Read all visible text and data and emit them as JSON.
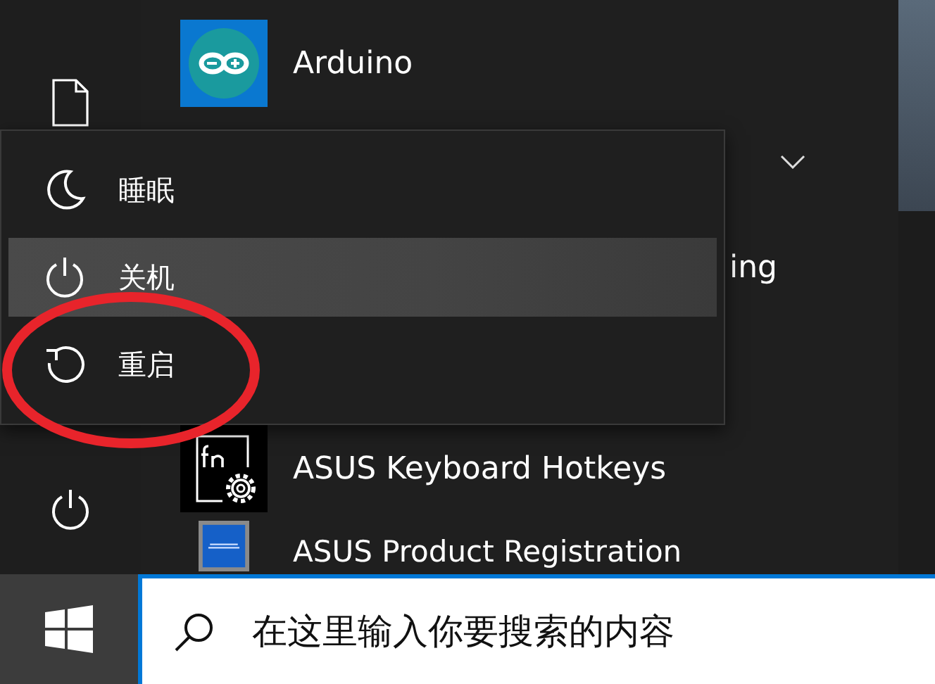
{
  "start_menu": {
    "apps": [
      {
        "kind": "strip"
      },
      {
        "kind": "app",
        "label": "Arduino"
      },
      {
        "kind": "strip"
      },
      {
        "kind": "group"
      },
      {
        "kind": "partial",
        "label": "ing"
      },
      {
        "kind": "app",
        "label": "ASUS Keyboard Hotkeys"
      },
      {
        "kind": "app",
        "label": "ASUS Product Registration"
      }
    ]
  },
  "power_menu": {
    "items": [
      {
        "kind": "sleep",
        "label": "睡眠",
        "selected": false
      },
      {
        "kind": "shutdown",
        "label": "关机",
        "selected": true
      },
      {
        "kind": "restart",
        "label": "重启",
        "selected": false
      }
    ]
  },
  "taskbar": {
    "search": {
      "placeholder": "在这里输入你要搜索的内容"
    }
  }
}
